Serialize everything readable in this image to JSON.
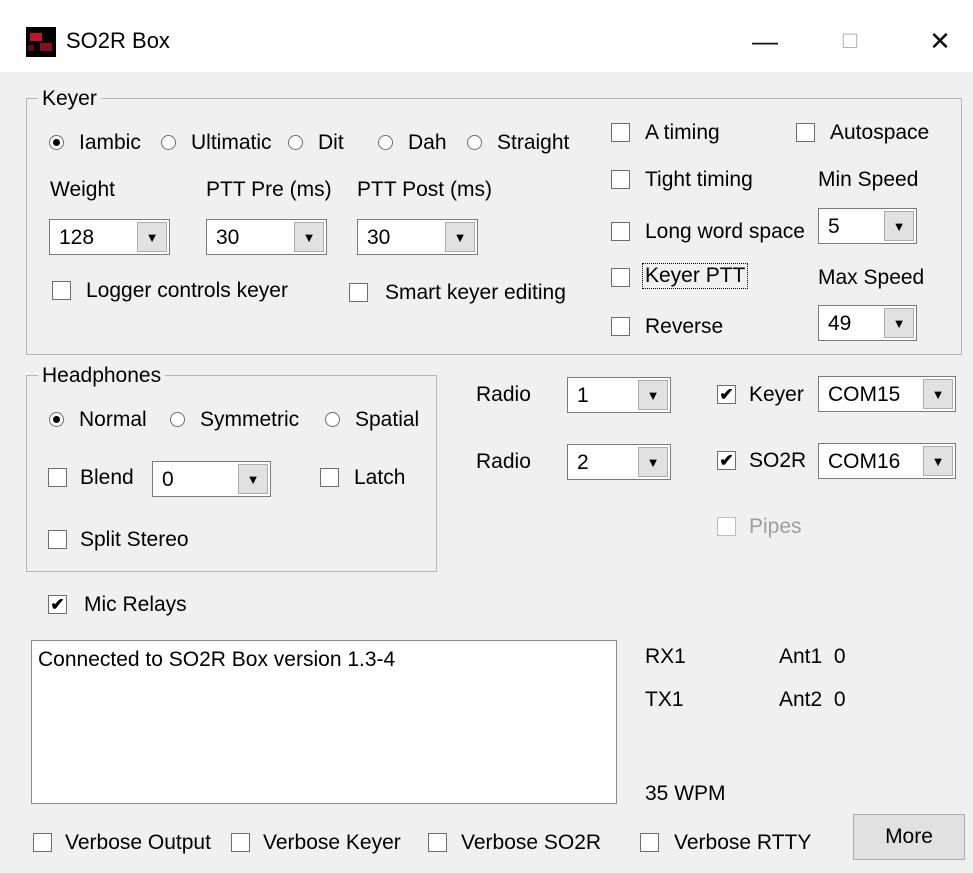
{
  "window": {
    "title": "SO2R Box",
    "minimize": "—",
    "maximize": "□",
    "close": "✕"
  },
  "keyer": {
    "legend": "Keyer",
    "modes": [
      {
        "label": "Iambic",
        "selected": true
      },
      {
        "label": "Ultimatic",
        "selected": false
      },
      {
        "label": "Dit",
        "selected": false
      },
      {
        "label": "Dah",
        "selected": false
      },
      {
        "label": "Straight",
        "selected": false
      }
    ],
    "weight_label": "Weight",
    "weight_value": "128",
    "ptt_pre_label": "PTT Pre (ms)",
    "ptt_pre_value": "30",
    "ptt_post_label": "PTT Post (ms)",
    "ptt_post_value": "30",
    "logger_controls_label": "Logger controls keyer",
    "logger_controls_checked": false,
    "smart_editing_label": "Smart keyer editing",
    "smart_editing_checked": false,
    "a_timing_label": "A timing",
    "tight_timing_label": "Tight timing",
    "long_word_space_label": "Long word space",
    "keyer_ptt_label": "Keyer PTT",
    "reverse_label": "Reverse",
    "autospace_label": "Autospace",
    "min_speed_label": "Min Speed",
    "min_speed_value": "5",
    "max_speed_label": "Max Speed",
    "max_speed_value": "49"
  },
  "headphones": {
    "legend": "Headphones",
    "modes": [
      {
        "label": "Normal",
        "selected": true
      },
      {
        "label": "Symmetric",
        "selected": false
      },
      {
        "label": "Spatial",
        "selected": false
      }
    ],
    "blend_label": "Blend",
    "blend_value": "0",
    "latch_label": "Latch",
    "split_stereo_label": "Split Stereo"
  },
  "radios": {
    "radio1_label": "Radio",
    "radio1_value": "1",
    "radio2_label": "Radio",
    "radio2_value": "2",
    "keyer_label": "Keyer",
    "keyer_checked": true,
    "keyer_port": "COM15",
    "so2r_label": "SO2R",
    "so2r_checked": true,
    "so2r_port": "COM16",
    "pipes_label": "Pipes",
    "pipes_checked": false
  },
  "mic_relays": {
    "label": "Mic Relays",
    "checked": true
  },
  "log": {
    "text": "Connected to SO2R Box version 1.3-4"
  },
  "status": {
    "rx": "RX1",
    "tx": "TX1",
    "ant1": "Ant1  0",
    "ant2": "Ant2  0",
    "wpm": "35 WPM"
  },
  "footer": {
    "verbose_output": "Verbose Output",
    "verbose_keyer": "Verbose Keyer",
    "verbose_so2r": "Verbose SO2R",
    "verbose_rtty": "Verbose RTTY",
    "more_button": "More"
  },
  "icons": {
    "dropdown": "▼",
    "check": "✔"
  }
}
